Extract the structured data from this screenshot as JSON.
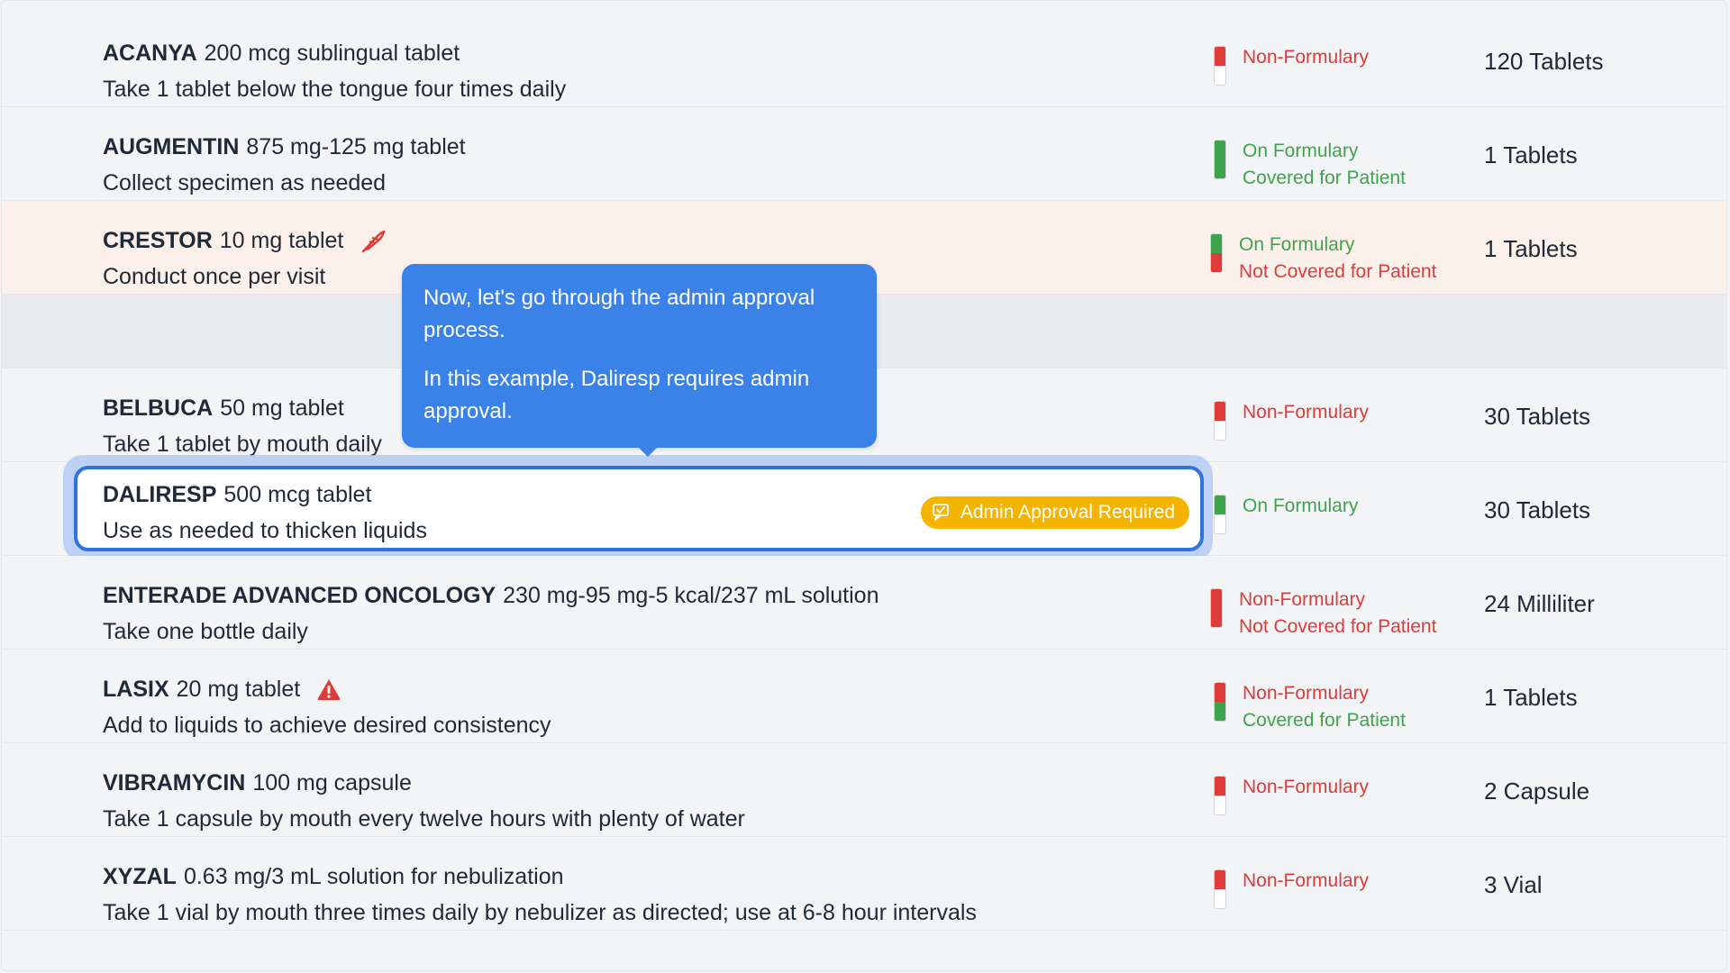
{
  "rows": [
    {
      "name": "ACANYA",
      "dose": "200 mcg sublingual tablet",
      "instructions": "Take 1 tablet below the tongue four times daily",
      "status1": "Non-Formulary",
      "status2": "",
      "quantity": "120 Tablets"
    },
    {
      "name": "AUGMENTIN",
      "dose": "875 mg-125 mg tablet",
      "instructions": "Collect specimen as needed",
      "status1": "On Formulary",
      "status2": "Covered for Patient",
      "quantity": "1 Tablets"
    },
    {
      "name": "CRESTOR",
      "dose": "10 mg tablet",
      "instructions": "Conduct once per visit",
      "status1": "On Formulary",
      "status2": "Not Covered for Patient",
      "quantity": "1 Tablets"
    },
    {
      "name": "BELBUCA",
      "dose": "50 mg tablet",
      "instructions": "Take 1 tablet by mouth daily",
      "status1": "Non-Formulary",
      "status2": "",
      "quantity": "30 Tablets"
    },
    {
      "name": "DALIRESP",
      "dose": "500 mcg tablet",
      "instructions": "Use as needed to thicken liquids",
      "status1": "On Formulary",
      "status2": "",
      "quantity": "30 Tablets",
      "badge": "Admin Approval Required"
    },
    {
      "name": "ENTERADE ADVANCED ONCOLOGY",
      "dose": "230 mg-95 mg-5 kcal/237 mL solution",
      "instructions": "Take one bottle daily",
      "status1": "Non-Formulary",
      "status2": "Not Covered for Patient",
      "quantity": "24 Milliliter"
    },
    {
      "name": "LASIX",
      "dose": "20 mg tablet",
      "instructions": "Add to liquids to achieve desired consistency",
      "status1": "Non-Formulary",
      "status2": "Covered for Patient",
      "quantity": "1 Tablets"
    },
    {
      "name": "VIBRAMYCIN",
      "dose": "100 mg capsule",
      "instructions": "Take 1 capsule by mouth every twelve hours with plenty of water",
      "status1": "Non-Formulary",
      "status2": "",
      "quantity": "2 Capsule"
    },
    {
      "name": "XYZAL",
      "dose": "0.63 mg/3 mL solution for nebulization",
      "instructions": "Take 1 vial by mouth three times daily by nebulizer as directed; use at 6-8 hour intervals",
      "status1": "Non-Formulary",
      "status2": "",
      "quantity": "3 Vial"
    }
  ],
  "tooltip": {
    "paragraph1": "Now, let's go through the admin approval process.",
    "paragraph2": "In this example, Daliresp requires admin approval."
  },
  "colors": {
    "formulary_red": "#e03b3b",
    "formulary_green": "#3fa34d",
    "highlight_row": "#fcf1ea",
    "tooltip_blue": "#3b82e8",
    "badge_amber": "#f5b400"
  },
  "icons": {
    "crestor": "feather-signature-icon",
    "lasix": "warning-triangle-icon",
    "badge": "approval-chat-icon"
  }
}
